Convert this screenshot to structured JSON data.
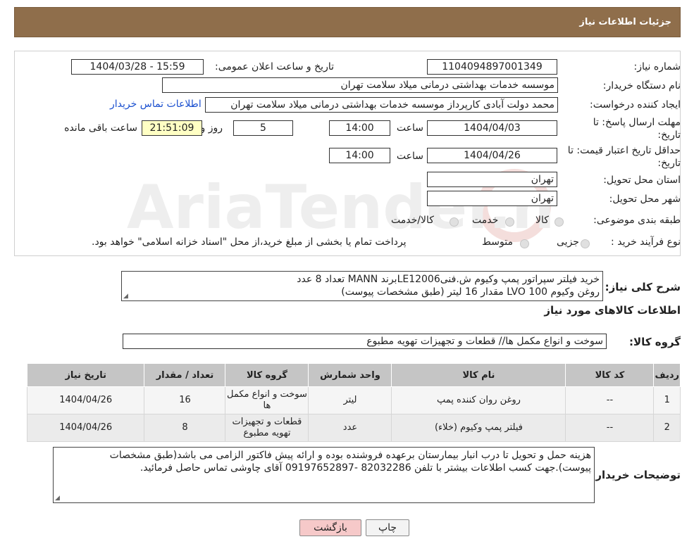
{
  "header": {
    "title": "جزئیات اطلاعات نیاز"
  },
  "form": {
    "need_number_label": "شماره نیاز:",
    "need_number_value": "1104094897001349",
    "announce_label": "تاریخ و ساعت اعلان عمومی:",
    "announce_value": "1404/03/28 - 15:59",
    "buyer_org_label": "نام دستگاه خریدار:",
    "buyer_org_value": "موسسه خدمات بهداشتی درمانی میلاد سلامت تهران",
    "creator_label": "ایجاد کننده درخواست:",
    "creator_value": "محمد دولت آبادی کارپرداز موسسه خدمات بهداشتی درمانی میلاد سلامت تهران",
    "contact_link": "اطلاعات تماس خریدار",
    "deadline_label_1": "مهلت ارسال پاسخ: تا",
    "deadline_label_2": "تاریخ:",
    "deadline_date": "1404/04/03",
    "time_label": "ساعت",
    "deadline_time": "14:00",
    "days_value": "5",
    "days_label": "روز و",
    "remaining_time": "21:51:09",
    "remaining_label": "ساعت باقی مانده",
    "validity_label_1": "حداقل تاریخ اعتبار قیمت: تا",
    "validity_label_2": "تاریخ:",
    "validity_date": "1404/04/26",
    "validity_time": "14:00",
    "province_label": "استان محل تحویل:",
    "province_value": "تهران",
    "city_label": "شهر محل تحویل:",
    "city_value": "تهران",
    "category_label": "طبقه بندی موضوعی:",
    "category_options": [
      "کالا",
      "خدمت",
      "کالا/خدمت"
    ],
    "process_label": "نوع فرآیند خرید :",
    "process_options": [
      "جزیی",
      "متوسط"
    ],
    "process_note": "پرداخت تمام یا بخشی از مبلغ خرید،از محل \"اسناد خزانه اسلامی\" خواهد بود."
  },
  "summary": {
    "label": "شرح کلی نیاز:",
    "line1": "خرید فیلتر سپراتور پمپ وکیوم ش.فنیLE12006برند MANN تعداد 8 عدد",
    "line2": "روغن وکیوم LVO 100 مقدار 16 لیتر (طبق مشخصات پیوست)"
  },
  "goods_info_title": "اطلاعات کالاهای مورد نیاز",
  "goods_group": {
    "label": "گروه کالا:",
    "value": "سوخت و انواع مکمل ها// قطعات و تجهیزات تهویه مطبوع"
  },
  "table": {
    "headers": [
      "ردیف",
      "کد کالا",
      "نام کالا",
      "واحد شمارش",
      "گروه کالا",
      "تعداد / مقدار",
      "تاریخ نیاز"
    ],
    "rows": [
      [
        "1",
        "--",
        "روغن روان کننده پمپ",
        "لیتر",
        "سوخت و انواع مکمل ها",
        "16",
        "1404/04/26"
      ],
      [
        "2",
        "--",
        "فیلتر پمپ وکیوم (خلاء)",
        "عدد",
        "قطعات و تجهیزات تهویه مطبوع",
        "8",
        "1404/04/26"
      ]
    ]
  },
  "buyer_notes": {
    "label": "توضیحات خریدار:",
    "text": "هزینه حمل و تحویل تا درب انبار بیمارستان برعهده فروشنده بوده و ارائه پیش فاکتور الزامی می باشد(طبق مشخصات پیوست).جهت کسب اطلاعات بیشتر با تلفن 82032286 -09197652897 آقای چاوشی تماس حاصل فرمائید."
  },
  "buttons": {
    "print": "چاپ",
    "back": "بازگشت"
  },
  "colors": {
    "header_bg": "#8f6e4b",
    "back_button_bg": "#f6c9c9",
    "highlight_box": "#ffffc4",
    "link": "#1a4fcf"
  }
}
